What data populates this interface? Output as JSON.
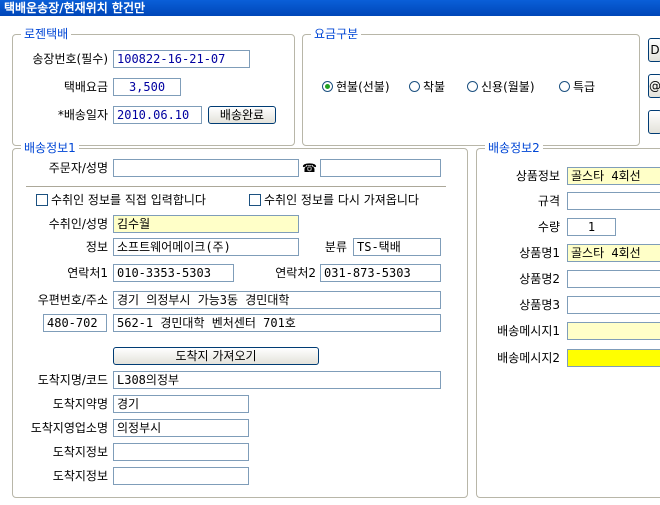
{
  "window": {
    "title": "택배운송장/현재위치 한건만"
  },
  "logen": {
    "title": "로젠택배",
    "waybill_label": "송장번호(필수)",
    "waybill_value": "100822-16-21-07",
    "fee_label": "택배요금",
    "fee_value": "3,500",
    "date_label": "*배송일자",
    "date_value": "2010.06.10",
    "complete_button": "배송완료"
  },
  "fee_type": {
    "title": "요금구분",
    "options": [
      {
        "label": "현불(선불)",
        "selected": true
      },
      {
        "label": "착불",
        "selected": false
      },
      {
        "label": "신용(월불)",
        "selected": false
      },
      {
        "label": "특급",
        "selected": false
      }
    ]
  },
  "right_buttons": {
    "top_glyph": "D",
    "mid_glyph": "@"
  },
  "delivery1": {
    "title": "배송정보1",
    "orderer_label": "주문자/성명",
    "orderer_value": "",
    "phone_icon": "phone-icon",
    "phone_glyph": "☎",
    "phone_value": "",
    "check_direct": "수취인 정보를 직접 입력합니다",
    "check_reload": "수취인 정보를 다시 가져옵니다",
    "recipient_label": "수취인/성명",
    "recipient_value": "김수월",
    "info_label": "정보",
    "info_value": "소프트웨어메이크(주)",
    "category_label": "분류",
    "category_value": "TS-택배",
    "contact1_label": "연락처1",
    "contact1_value": "010-3353-5303",
    "contact2_label": "연락처2",
    "contact2_value": "031-873-5303",
    "address_label": "우편번호/주소",
    "address1_value": "경기 의정부시 가능3동 경민대학",
    "zip_value": "480-702",
    "address2_value": "562-1 경민대학 벤처센터 701호",
    "fetch_button": "도착지 가져오기",
    "dest_code_label": "도착지명/코드",
    "dest_code_value": "L308의정부",
    "dest_abbr_label": "도착지약명",
    "dest_abbr_value": "경기",
    "dest_office_label": "도착지영업소명",
    "dest_office_value": "의정부시",
    "dest_info1_label": "도착지정보",
    "dest_info1_value": "",
    "dest_info2_label": "도착지정보",
    "dest_info2_value": ""
  },
  "delivery2": {
    "title": "배송정보2",
    "product_info_label": "상품정보",
    "product_info_value": "골스타 4회선",
    "spec_label": "규격",
    "spec_value": "",
    "qty_label": "수량",
    "qty_value": "1",
    "product1_label": "상품명1",
    "product1_value": "골스타 4회선",
    "product2_label": "상품명2",
    "product2_value": "",
    "product3_label": "상품명3",
    "product3_value": "",
    "msg1_label": "배송메시지1",
    "msg1_value": "",
    "msg2_label": "배송메시지2",
    "msg2_value": ""
  },
  "colors": {
    "title_bar": "#0a5fd8",
    "group_title": "#0046d5",
    "highlight": "#ffff00",
    "field_text": "#0000a0"
  }
}
